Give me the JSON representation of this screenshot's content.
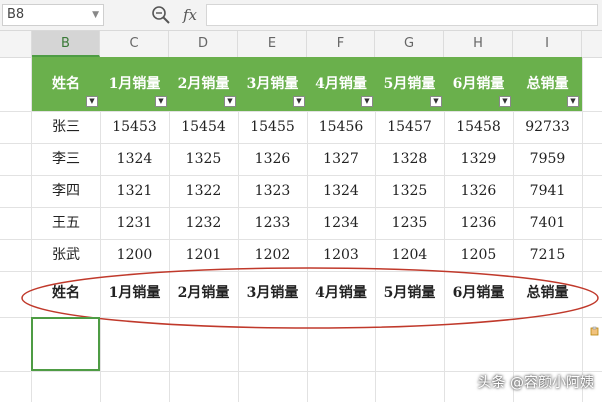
{
  "formula_bar": {
    "cell_ref": "B8",
    "fx_label": "fx",
    "formula": ""
  },
  "columns": [
    "B",
    "C",
    "D",
    "E",
    "F",
    "G",
    "H",
    "I"
  ],
  "selected_column": "B",
  "table": {
    "headers": [
      "姓名",
      "1月销量",
      "2月销量",
      "3月销量",
      "4月销量",
      "5月销量",
      "6月销量",
      "总销量"
    ],
    "rows": [
      [
        "张三",
        "15453",
        "15454",
        "15455",
        "15456",
        "15457",
        "15458",
        "92733"
      ],
      [
        "李三",
        "1324",
        "1325",
        "1326",
        "1327",
        "1328",
        "1329",
        "7959"
      ],
      [
        "李四",
        "1321",
        "1322",
        "1323",
        "1324",
        "1325",
        "1326",
        "7941"
      ],
      [
        "王五",
        "1231",
        "1232",
        "1233",
        "1234",
        "1235",
        "1236",
        "7401"
      ],
      [
        "张武",
        "1200",
        "1201",
        "1202",
        "1203",
        "1204",
        "1205",
        "7215"
      ]
    ],
    "summary_row": [
      "姓名",
      "1月销量",
      "2月销量",
      "3月销量",
      "4月销量",
      "5月销量",
      "6月销量",
      "总销量"
    ]
  },
  "colors": {
    "header_green": "#6ab04c",
    "annotation_red": "#c0392b",
    "selection_green": "#4e9c44"
  },
  "watermark": "头条 @容颜小阿姨"
}
